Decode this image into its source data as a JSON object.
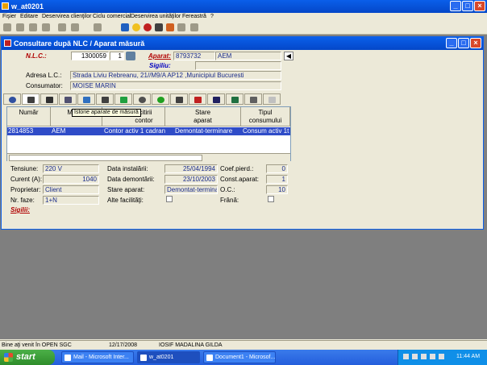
{
  "window": {
    "title": "w_at0201"
  },
  "menu": [
    "Fişier",
    "Editare",
    "Deservirea clienţilor",
    "Ciclu comercial",
    "Deservirea unităţilor",
    "Fereastră",
    "?"
  ],
  "child": {
    "title": "Consultare după NLC / Aparat măsură"
  },
  "form": {
    "nlc_label": "N.L.C.:",
    "nlc_value": "1300059",
    "nlc_seq": "1",
    "aparat_label": "Aparat:",
    "aparat_value": "8793732",
    "aparat_brand": "AEM",
    "sigiliu_label": "Sigiliu:",
    "adresa_label": "Adresa L.C.:",
    "adresa_value": "Strada Liviu Rebreanu, 21//M9/A AP12 ,Municipiul Bucuresti",
    "consumator_label": "Consumator:",
    "consumator_value": "MOISE  MARIN"
  },
  "tooltip": "Istorie aparate de măsură",
  "grid": {
    "headers": [
      "Număr",
      "Marca",
      "Data ultimei citiri contor",
      "Stare aparat",
      "Tipul consumului"
    ],
    "header_visible": [
      "Număr",
      "Marca",
      "l citirii\ncontor",
      "Stare\naparat",
      "Tipul\nconsumului"
    ],
    "row": {
      "numar": "2814853",
      "marca": "AEM",
      "tip": "Contor activ 1 cadran",
      "stare": "Demontat-terminare",
      "consum": "Consum activ 1t"
    }
  },
  "details": {
    "tensiune_label": "Tensiune:",
    "tensiune": "220 V",
    "curent_label": "Curent (A):",
    "curent": "1040",
    "proprietar_label": "Proprietar:",
    "proprietar": "Client",
    "faze_label": "Nr. faze:",
    "faze": "1+N",
    "sigilii_label": "Sigilii:",
    "instalare_label": "Data instalării:",
    "instalare": "25/04/1994",
    "demontare_label": "Data demontării:",
    "demontare": "23/10/2003",
    "stare_label": "Stare aparat:",
    "stare": "Demontat-terminar",
    "alte_label": "Alte facilităţi:",
    "coef_label": "Coef.pierd.:",
    "coef": "0",
    "const_label": "Const.aparat:",
    "const": "1",
    "oc_label": "O.C.:",
    "oc": "10",
    "frana_label": "Frână:"
  },
  "status": {
    "msg": "Bine aţi venit în OPEN SGC",
    "date": "12/17/2008",
    "user": "IOSIF MADALINA GILDA"
  },
  "taskbar": {
    "start": "start",
    "tasks": [
      "Mail - Microsoft Inter...",
      "w_at0201",
      "Document1 - Microsof..."
    ],
    "clock": "11:44 AM"
  }
}
